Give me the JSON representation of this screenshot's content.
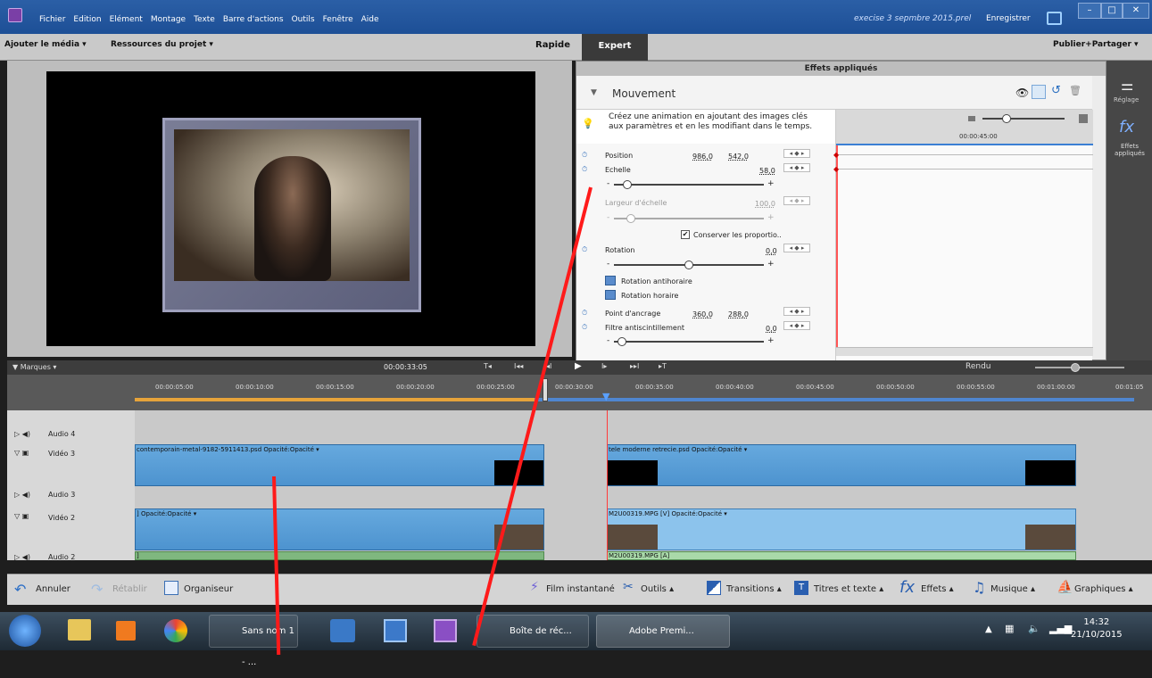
{
  "menu": {
    "items": [
      "Fichier",
      "Edition",
      "Elément",
      "Montage",
      "Texte",
      "Barre d'actions",
      "Outils",
      "Fenêtre",
      "Aide"
    ],
    "project_title": "execise 3 sepmbre 2015.prel",
    "save_label": "Enregistrer",
    "win_minimize": "–",
    "win_restore": "□",
    "win_close": "✕"
  },
  "toolbar": {
    "add_media": "Ajouter le média ▾",
    "project_resources": "Ressources du projet ▾",
    "quick": "Rapide",
    "expert": "Expert",
    "publish": "Publier+Partager ▾"
  },
  "effects": {
    "header": "Effets appliqués",
    "section": "Mouvement",
    "tooltip": "Créez une animation en ajoutant des images clés aux paramètres et en les modifiant dans le temps.",
    "position_label": "Position",
    "position_x": "986,0",
    "position_y": "542,0",
    "scale_label": "Echelle",
    "scale_value": "58,0",
    "scale_width_label": "Largeur d'échelle",
    "scale_width_value": "100,0",
    "keep_proportions": "Conserver les proportio..",
    "rotation_label": "Rotation",
    "rotation_value": "0,0",
    "rot_ccw": "Rotation antihoraire",
    "rot_cw": "Rotation horaire",
    "anchor_label": "Point d'ancrage",
    "anchor_x": "360,0",
    "anchor_y": "288,0",
    "antiflicker_label": "Filtre antiscintillement",
    "antiflicker_value": "0,0",
    "mini_timecode": "00:00:45:00",
    "kf_buttons": "◂ ◆ ▸",
    "slider_minus": "-",
    "slider_plus": "+"
  },
  "side": {
    "adjust": "Réglage",
    "applied_effects": "Effets appliqués"
  },
  "marks": {
    "label": "▼ Marques ▾",
    "timecode": "00:00:33:05",
    "render": "Rendu",
    "controls": [
      "T◂",
      "I◂◂",
      "◂I",
      "▶",
      "I▸",
      "▸▸I",
      "▸T"
    ]
  },
  "ruler": {
    "ticks": [
      "00:00:05:00",
      "00:00:10:00",
      "00:00:15:00",
      "00:00:20:00",
      "00:00:25:00",
      "00:00:30:00",
      "00:00:35:00",
      "00:00:40:00",
      "00:00:45:00",
      "00:00:50:00",
      "00:00:55:00",
      "00:01:00:00",
      "00:01:05"
    ]
  },
  "tracks": {
    "audio4": "Audio 4",
    "video3": "Vidéo 3",
    "audio3": "Audio 3",
    "video2": "Vidéo 2",
    "audio2": "Audio 2",
    "clip_v3a": "contemporain-metal-9182-5911413.psd  Opacité:Opacité ▾",
    "clip_v3b": "tele moderne retrecie.psd  Opacité:Opacité ▾",
    "clip_v2a": "] Opacité:Opacité ▾",
    "clip_v2b": "M2U00319.MPG [V]  Opacité:Opacité ▾",
    "clip_a2a": "]",
    "clip_a2b": "M2U00319.MPG [A]"
  },
  "bottom": {
    "undo": "Annuler",
    "redo": "Rétablir",
    "organizer": "Organiseur",
    "instant_movie": "Film instantané",
    "tools": "Outils ▴",
    "transitions": "Transitions ▴",
    "titles": "Titres et texte ▴",
    "effects": "Effets ▴",
    "music": "Musique ▴",
    "graphics": "Graphiques ▴"
  },
  "taskbar": {
    "untitled": "Sans nom 1 - ...",
    "chrome": "Boîte de réc...",
    "premiere": "Adobe Premi...",
    "time": "14:32",
    "date": "21/10/2015"
  }
}
